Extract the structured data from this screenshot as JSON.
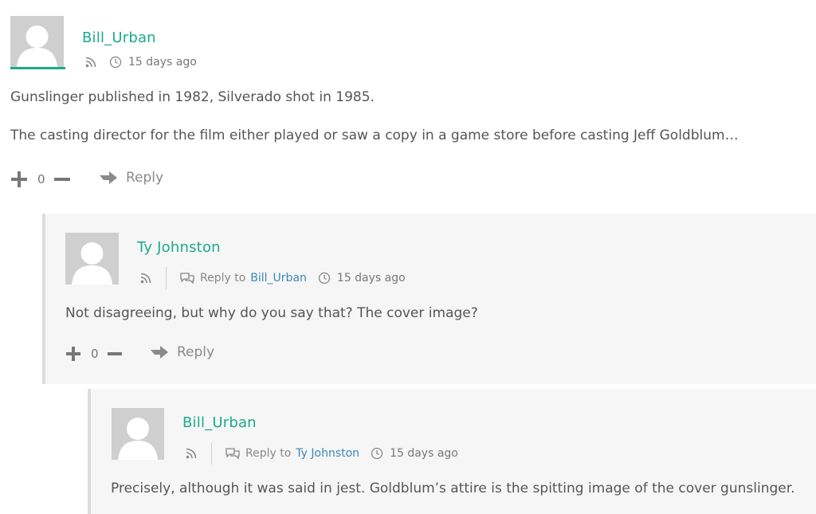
{
  "comments": [
    {
      "author": "Bill_Urban",
      "time": "15 days ago",
      "paragraphs": [
        "Gunslinger published in 1982, Silverado shot in 1985.",
        "The casting director for the film either played or saw a copy in a game store before casting Jeff Goldblum…"
      ],
      "votes": "0",
      "reply_label": "Reply"
    },
    {
      "author": "Ty Johnston",
      "reply_to_label": "Reply to",
      "reply_to_name": "Bill_Urban",
      "time": "15 days ago",
      "paragraphs": [
        "Not disagreeing, but why do you say that? The cover image?"
      ],
      "votes": "0",
      "reply_label": "Reply"
    },
    {
      "author": "Bill_Urban",
      "reply_to_label": "Reply to",
      "reply_to_name": "Ty Johnston",
      "time": "15 days ago",
      "paragraphs": [
        "Precisely, although it was said in jest. Goldblum’s attire is the spitting image of the cover gunslinger."
      ]
    }
  ],
  "icons": {
    "feed": "rss-icon",
    "time": "clock-icon",
    "reply_to": "speech-bubbles-icon",
    "upvote": "plus-icon",
    "downvote": "minus-icon",
    "reply": "reply-arrow-icon"
  },
  "colors": {
    "author": "#1aab8a",
    "link": "#3a87b8",
    "text": "#555555",
    "child_background": "#f6f6f6",
    "avatar": "#cfcfcf"
  }
}
